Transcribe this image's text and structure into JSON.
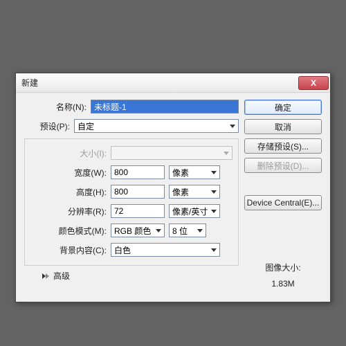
{
  "dialog": {
    "title": "新建",
    "close_glyph": "X"
  },
  "form": {
    "name_label": "名称(N):",
    "name_value": "未标题-1",
    "preset_label": "预设(P):",
    "preset_value": "自定",
    "size_label": "大小(I):",
    "size_value": "",
    "width_label": "宽度(W):",
    "width_value": "800",
    "width_unit": "像素",
    "height_label": "高度(H):",
    "height_value": "800",
    "height_unit": "像素",
    "resolution_label": "分辨率(R):",
    "resolution_value": "72",
    "resolution_unit": "像素/英寸",
    "colormode_label": "颜色模式(M):",
    "colormode_value": "RGB 颜色",
    "colordepth_value": "8 位",
    "bg_label": "背景内容(C):",
    "bg_value": "白色",
    "advanced_label": "高级"
  },
  "buttons": {
    "ok": "确定",
    "cancel": "取消",
    "save_preset": "存储预设(S)...",
    "delete_preset": "删除预设(D)...",
    "device_central": "Device Central(E)..."
  },
  "info": {
    "imagesize_label": "图像大小:",
    "imagesize_value": "1.83M"
  }
}
